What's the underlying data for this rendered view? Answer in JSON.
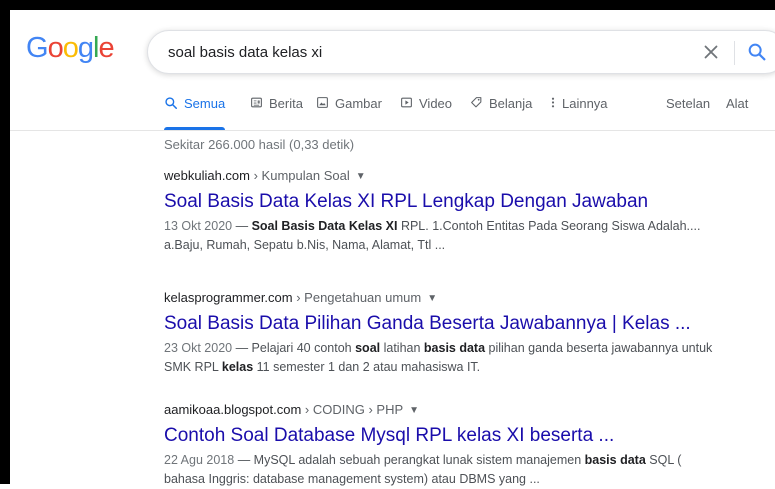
{
  "logo": {
    "text": "Google",
    "letters": [
      "G",
      "o",
      "o",
      "g",
      "l",
      "e"
    ],
    "colors": [
      "#4285F4",
      "#EA4335",
      "#FBBC05",
      "#4285F4",
      "#34A853",
      "#EA4335"
    ]
  },
  "search": {
    "query": "soal basis data kelas xi"
  },
  "tabs": [
    {
      "label": "Semua",
      "icon": "search-icon",
      "active": true
    },
    {
      "label": "Berita",
      "icon": "news-icon"
    },
    {
      "label": "Gambar",
      "icon": "image-icon"
    },
    {
      "label": "Video",
      "icon": "video-icon"
    },
    {
      "label": "Belanja",
      "icon": "tag-icon"
    },
    {
      "label": "Lainnya",
      "icon": "more-vert-icon"
    }
  ],
  "tools": {
    "settings": "Setelan",
    "tools": "Alat"
  },
  "stats": "Sekitar 266.000 hasil (0,33 detik)",
  "results": [
    {
      "domain": "webkuliah.com",
      "path": " › Kumpulan Soal",
      "title": "Soal Basis Data Kelas XI RPL Lengkap Dengan Jawaban",
      "date": "13 Okt 2020",
      "snippet_parts": [
        {
          "t": " — "
        },
        {
          "t": "Soal Basis Data Kelas XI",
          "b": true
        },
        {
          "t": " RPL. 1.Contoh Entitas Pada Seorang Siswa Adalah.... a.Baju, Rumah, Sepatu b.Nis, Nama, Alamat, Ttl ..."
        }
      ]
    },
    {
      "domain": "kelasprogrammer.com",
      "path": " › Pengetahuan umum",
      "title": "Soal Basis Data Pilihan Ganda Beserta Jawabannya | Kelas ...",
      "date": "23 Okt 2020",
      "snippet_parts": [
        {
          "t": " — Pelajari 40 contoh "
        },
        {
          "t": "soal",
          "b": true
        },
        {
          "t": " latihan "
        },
        {
          "t": "basis data",
          "b": true
        },
        {
          "t": " pilihan ganda beserta jawabannya untuk SMK RPL "
        },
        {
          "t": "kelas",
          "b": true
        },
        {
          "t": " 11 semester 1 dan 2 atau mahasiswa IT."
        }
      ]
    },
    {
      "domain": "aamikoaa.blogspot.com",
      "path": " › CODING › PHP",
      "title": "Contoh Soal Database Mysql RPL kelas XI beserta ...",
      "date": "22 Agu 2018",
      "snippet_parts": [
        {
          "t": " — MySQL adalah sebuah perangkat lunak sistem manajemen "
        },
        {
          "t": "basis data",
          "b": true
        },
        {
          "t": " SQL ( bahasa Inggris: database management system) atau DBMS yang ..."
        }
      ]
    }
  ]
}
